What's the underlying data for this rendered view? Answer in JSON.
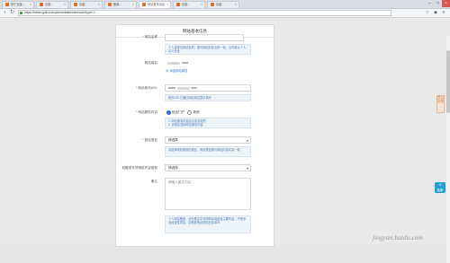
{
  "browser": {
    "tabs": [
      {
        "label": "基于百度..."
      },
      {
        "label": "百度..."
      },
      {
        "label": "百度..."
      },
      {
        "label": "备案..."
      },
      {
        "label": "网站基本信息"
      },
      {
        "label": "百度..."
      },
      {
        "label": "百度..."
      }
    ],
    "active_tab_index": 4,
    "url": "https://beian.gdb.cn/node/website/site/node/type=1"
  },
  "form": {
    "title": "网站基本信息",
    "website_name": {
      "label": "网站名称",
      "value": "",
      "hint": "个人或单位网站名称，需与网站实际名称一致，且不能以个人名义开设"
    },
    "domain": {
      "label": "网站域名",
      "value_prefix": "",
      "value_suffix": ".com",
      "add_link": "添加网站域名"
    },
    "homepage": {
      "label": "网站首页URL",
      "value_prefix": "www.",
      "value_suffix": ".com",
      "hint": "首页URL已通过网站域名提示填写"
    },
    "service": {
      "label": "网站服务内容",
      "options": [
        "综合门户",
        "其他"
      ],
      "selected_index": 0,
      "hint": "1. 网站服务内容应与实际相符\n2. 请如实选择网站服务内容"
    },
    "language": {
      "label": "网站语言",
      "value": "请选择",
      "hint": "请选择网站使用的语言，网站语言需与网站内容实际一致"
    },
    "frontend_access": {
      "label": "前置或专项审批内容类型",
      "value": "请选择"
    },
    "remark": {
      "label": "备注",
      "placeholder": "请输入备注内容",
      "hint": "个人网站备案，请在备注中写明网站用途及主要内容，不得涉及经营性内容，如有其他说明请在此填写"
    }
  },
  "side": {
    "feedback_label": "意见反馈",
    "service_label": "客服"
  },
  "watermark": "jingyan.baidu.com"
}
